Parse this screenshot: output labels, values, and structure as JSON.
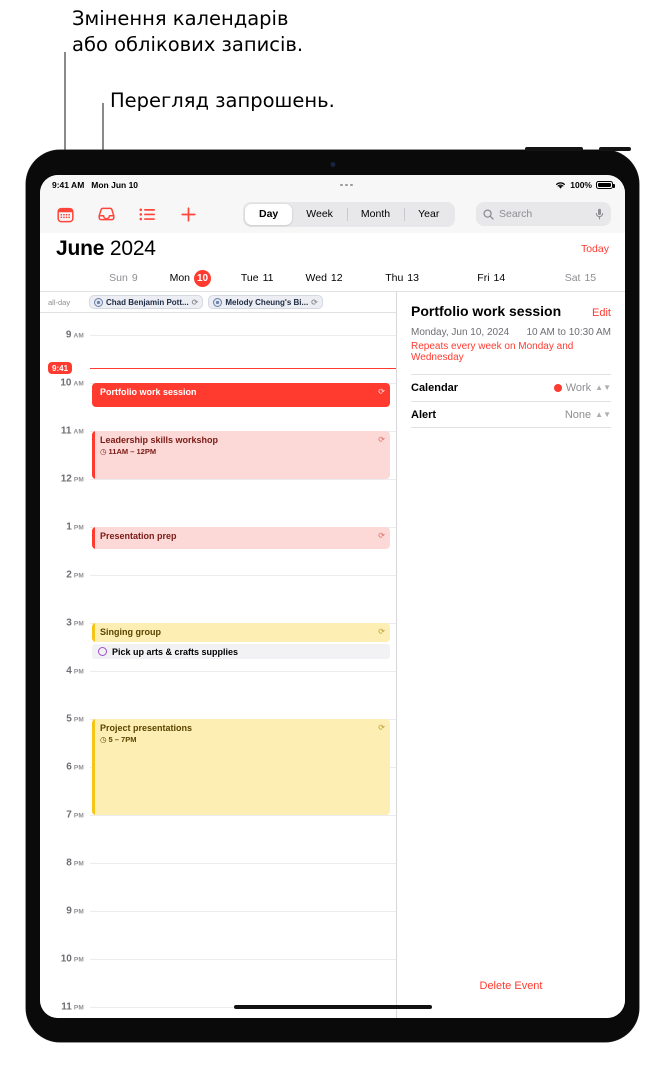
{
  "callouts": [
    {
      "id": "callout-calendars",
      "text": "Змінення календарів\nабо облікових записів."
    },
    {
      "id": "callout-invitations",
      "text": "Перегляд запрошень."
    }
  ],
  "statusbar": {
    "time": "9:41 AM",
    "date": "Mon Jun 10",
    "battery_percent": "100%",
    "wifi_icon": "wifi-icon",
    "battery_icon": "battery-icon",
    "menu_icon": "more-dots-icon"
  },
  "toolbar": {
    "icons": [
      {
        "name": "calendars-icon",
        "label": "Calendars"
      },
      {
        "name": "inbox-icon",
        "label": "Inbox"
      },
      {
        "name": "list-icon",
        "label": "List"
      },
      {
        "name": "add-event-icon",
        "label": "Add"
      }
    ],
    "segments": [
      {
        "label": "Day",
        "selected": true
      },
      {
        "label": "Week",
        "selected": false
      },
      {
        "label": "Month",
        "selected": false
      },
      {
        "label": "Year",
        "selected": false
      }
    ],
    "search": {
      "placeholder": "Search",
      "search_icon": "search-icon",
      "mic_icon": "microphone-icon"
    }
  },
  "header": {
    "month": "June",
    "year": "2024",
    "today_label": "Today"
  },
  "days": [
    {
      "label": "Sun 9",
      "weekday": "Sun",
      "num": "9",
      "dim": true,
      "selected": false
    },
    {
      "label": "Mon 10",
      "weekday": "Mon",
      "num": "10",
      "dim": false,
      "selected": true
    },
    {
      "label": "Tue 11",
      "weekday": "Tue",
      "num": "11",
      "dim": false,
      "selected": false
    },
    {
      "label": "Wed 12",
      "weekday": "Wed",
      "num": "12",
      "dim": false,
      "selected": false
    },
    {
      "label": "Thu 13",
      "weekday": "Thu",
      "num": "13",
      "dim": false,
      "selected": false
    },
    {
      "label": "Fri 14",
      "weekday": "Fri",
      "num": "14",
      "dim": false,
      "selected": false
    },
    {
      "label": "Sat 15",
      "weekday": "Sat",
      "num": "15",
      "dim": true,
      "selected": false
    }
  ],
  "allday": {
    "label": "all-day",
    "events": [
      {
        "title": "Chad Benjamin Pott...",
        "repeat_icon": "repeat-icon"
      },
      {
        "title": "Melody Cheung's Bi...",
        "repeat_icon": "repeat-icon"
      }
    ]
  },
  "timeline": {
    "hours": [
      {
        "h": "9",
        "ap": "AM"
      },
      {
        "h": "10",
        "ap": "AM"
      },
      {
        "h": "11",
        "ap": "AM"
      },
      {
        "h": "12",
        "ap": "PM"
      },
      {
        "h": "1",
        "ap": "PM"
      },
      {
        "h": "2",
        "ap": "PM"
      },
      {
        "h": "3",
        "ap": "PM"
      },
      {
        "h": "4",
        "ap": "PM"
      },
      {
        "h": "5",
        "ap": "PM"
      },
      {
        "h": "6",
        "ap": "PM"
      },
      {
        "h": "7",
        "ap": "PM"
      },
      {
        "h": "8",
        "ap": "PM"
      },
      {
        "h": "9",
        "ap": "PM"
      },
      {
        "h": "10",
        "ap": "PM"
      },
      {
        "h": "11",
        "ap": "PM"
      }
    ],
    "now_label": "9:41",
    "events": [
      {
        "title": "Portfolio work session",
        "time": "",
        "style": "solid",
        "repeat_icon": "repeat-icon"
      },
      {
        "title": "Leadership skills workshop",
        "time": "11AM – 12PM",
        "style": "tint-red",
        "repeat_icon": "repeat-icon",
        "clock_icon": "clock-icon"
      },
      {
        "title": "Presentation prep",
        "time": "",
        "style": "tint-red",
        "repeat_icon": "repeat-icon"
      },
      {
        "title": "Singing group",
        "time": "",
        "style": "tint-yel",
        "repeat_icon": "repeat-icon"
      },
      {
        "title": "Project presentations",
        "time": "5 – 7PM",
        "style": "tint-yel",
        "repeat_icon": "repeat-icon",
        "clock_icon": "clock-icon"
      }
    ],
    "reminder": {
      "title": "Pick up arts & crafts supplies",
      "circle_icon": "reminder-circle-icon"
    }
  },
  "detail": {
    "title": "Portfolio work session",
    "edit_label": "Edit",
    "date": "Monday, Jun 10, 2024",
    "time": "10 AM to 10:30 AM",
    "repeat": "Repeats every week on Monday and Wednesday",
    "rows": [
      {
        "label": "Calendar",
        "value": "Work",
        "dot": true
      },
      {
        "label": "Alert",
        "value": "None",
        "dot": false
      }
    ],
    "delete_label": "Delete Event"
  },
  "colors": {
    "accent_red": "#ff3b30",
    "yellow": "#f5c518",
    "purple": "#9b4dca",
    "chip_blue": "#6b7fa8"
  }
}
